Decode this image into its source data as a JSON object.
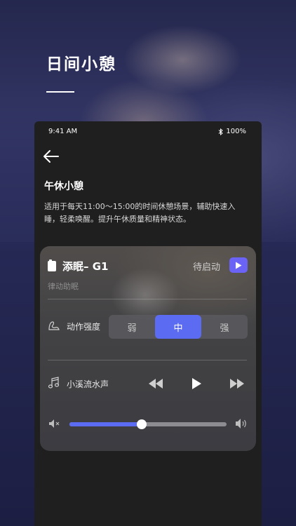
{
  "header": {
    "title": "日间小憩"
  },
  "status_bar": {
    "time": "9:41 AM",
    "battery": "100%"
  },
  "screen": {
    "title": "午休小憩",
    "description": "适用于每天11:00～15:00的时间休憩场景，辅助快速入睡，轻柔唤醒。提升午休质量和精神状态。"
  },
  "device": {
    "name": "添眠– G1",
    "status": "待启动",
    "subtitle": "律动助眠"
  },
  "intensity": {
    "label": "动作强度",
    "options": [
      "弱",
      "中",
      "强"
    ],
    "selected": "中"
  },
  "music": {
    "track": "小溪流水声"
  },
  "volume": {
    "level": 0.46
  },
  "colors": {
    "accent": "#5b6cf3",
    "start_button": "#6a63f5"
  },
  "icons": [
    "back-arrow-icon",
    "bluetooth-icon",
    "device-icon",
    "play-icon",
    "intensity-icon",
    "music-note-icon",
    "rewind-icon",
    "forward-icon",
    "volume-low-icon",
    "volume-high-icon"
  ]
}
